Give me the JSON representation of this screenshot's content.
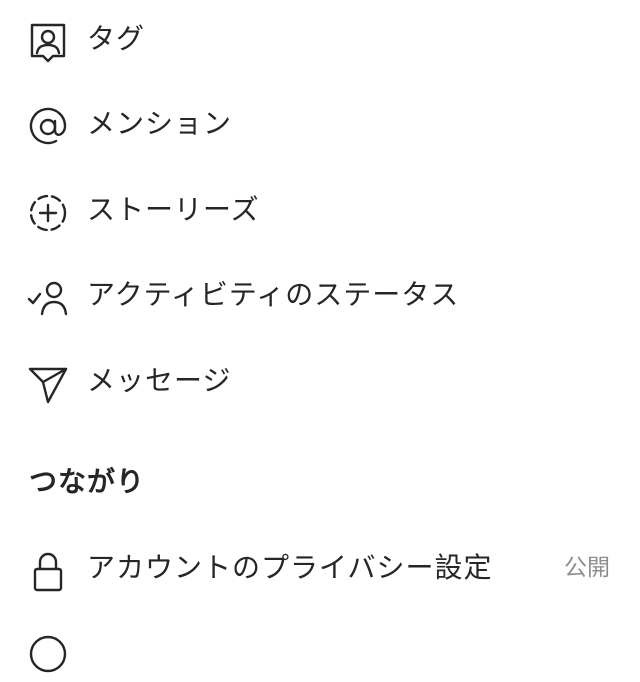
{
  "menu": {
    "items": [
      {
        "label": "タグ",
        "icon": "tag-person-icon"
      },
      {
        "label": "メンション",
        "icon": "at-mention-icon"
      },
      {
        "label": "ストーリーズ",
        "icon": "story-add-icon"
      },
      {
        "label": "アクティビティのステータス",
        "icon": "person-check-icon"
      },
      {
        "label": "メッセージ",
        "icon": "paper-plane-icon"
      }
    ]
  },
  "connections": {
    "header": "つながり",
    "items": [
      {
        "label": "アカウントのプライバシー設定",
        "value": "公開",
        "icon": "lock-icon"
      },
      {
        "label": "",
        "icon": "partial-icon"
      }
    ]
  }
}
